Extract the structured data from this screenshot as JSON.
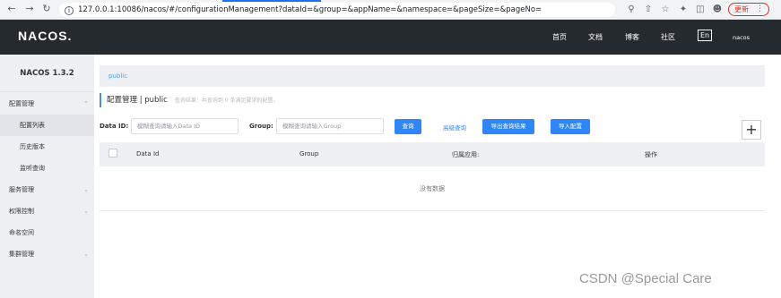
{
  "browser": {
    "url": "127.0.0.1:10086/nacos/#/configurationManagement?dataId=&group=&appName=&namespace=&pageSize=&pageNo=",
    "back_icon": "arrow-left",
    "forward_icon": "arrow-right",
    "reload_icon": "reload",
    "update_label": "更新"
  },
  "topnav": {
    "logo": "NACOS.",
    "items": [
      "首页",
      "文档",
      "博客",
      "社区"
    ],
    "lang": "En",
    "user": "nacos"
  },
  "sidebar": {
    "version": "NACOS 1.3.2",
    "items": [
      {
        "label": "配置管理"
      },
      {
        "label": "配置列表"
      },
      {
        "label": "历史版本"
      },
      {
        "label": "监听查询"
      },
      {
        "label": "服务管理"
      },
      {
        "label": "权限控制"
      },
      {
        "label": "命名空间"
      },
      {
        "label": "集群管理"
      }
    ]
  },
  "main": {
    "breadcrumb": "public",
    "title": "配置管理 | public",
    "hint": "查询结果：共查询到 0 条满足要求的配置。",
    "filters": {
      "dataid_label": "Data ID:",
      "dataid_placeholder": "模糊查询请输入Data ID",
      "group_label": "Group:",
      "group_placeholder": "模糊查询请输入Group"
    },
    "buttons": {
      "search": "查询",
      "advanced": "高级查询",
      "export": "导出查询结果",
      "import": "导入配置",
      "add": "+"
    },
    "table": {
      "columns": [
        "Data Id",
        "Group",
        "归属应用:",
        "操作"
      ],
      "empty_text": "没有数据"
    }
  },
  "watermark": "CSDN @Special Care",
  "colors": {
    "accent": "#2f86f6",
    "topnav": "#252a2f",
    "sidebar": "#eef0f3"
  }
}
